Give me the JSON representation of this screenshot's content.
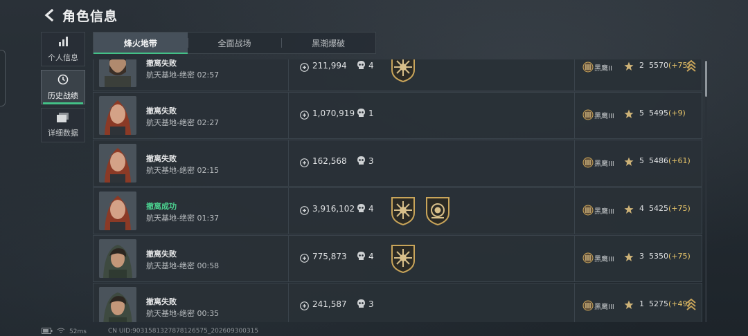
{
  "header": {
    "title": "角色信息"
  },
  "sidebar": [
    {
      "label": "个人信息",
      "icon": "bar-chart-icon",
      "active": false
    },
    {
      "label": "历史战绩",
      "icon": "clock-icon",
      "active": true
    },
    {
      "label": "详细数据",
      "icon": "folder-icon",
      "active": false
    }
  ],
  "tabs": [
    {
      "label": "烽火地带",
      "active": true
    },
    {
      "label": "全面战场",
      "active": false
    },
    {
      "label": "黑潮爆破",
      "active": false
    }
  ],
  "rows": [
    {
      "status": "撤离失败",
      "success": false,
      "map": "航天基地-绝密",
      "time": "02:57",
      "value": "211,994",
      "kills": "4",
      "badges": [
        "sun-badge"
      ],
      "rank": "黑鹰II",
      "stars": "2",
      "score": "5570",
      "delta": "(+75)",
      "chevron": true,
      "avatar": "male-bearded"
    },
    {
      "status": "撤离失败",
      "success": false,
      "map": "航天基地-绝密",
      "time": "02:27",
      "value": "1,070,919",
      "kills": "1",
      "badges": [],
      "rank": "黑鹰III",
      "stars": "5",
      "score": "5495",
      "delta": "(+9)",
      "chevron": false,
      "avatar": "female-red"
    },
    {
      "status": "撤离失败",
      "success": false,
      "map": "航天基地-绝密",
      "time": "02:15",
      "value": "162,568",
      "kills": "3",
      "badges": [],
      "rank": "黑鹰III",
      "stars": "5",
      "score": "5486",
      "delta": "(+61)",
      "chevron": false,
      "avatar": "female-red"
    },
    {
      "status": "撤离成功",
      "success": true,
      "map": "航天基地-绝密",
      "time": "01:37",
      "value": "3,916,102",
      "kills": "4",
      "badges": [
        "sun-badge",
        "emblem-badge"
      ],
      "rank": "黑鹰III",
      "stars": "4",
      "score": "5425",
      "delta": "(+75)",
      "chevron": false,
      "avatar": "female-red"
    },
    {
      "status": "撤离失败",
      "success": false,
      "map": "航天基地-绝密",
      "time": "00:58",
      "value": "775,873",
      "kills": "4",
      "badges": [
        "sun-badge"
      ],
      "rank": "黑鹰III",
      "stars": "3",
      "score": "5350",
      "delta": "(+75)",
      "chevron": false,
      "avatar": "female-hood"
    },
    {
      "status": "撤离失败",
      "success": false,
      "map": "航天基地-绝密",
      "time": "00:35",
      "value": "241,587",
      "kills": "3",
      "badges": [],
      "rank": "黑鹰III",
      "stars": "1",
      "score": "5275",
      "delta": "(+49)",
      "chevron": true,
      "avatar": "female-hood"
    }
  ],
  "footer": {
    "ping": "52ms",
    "uid": "CN UID:903158132787812657­5_202609300315"
  },
  "colors": {
    "accent": "#43c187",
    "success": "#4bd18f",
    "delta": "#e9c66a",
    "gold": "#c9a55a"
  }
}
